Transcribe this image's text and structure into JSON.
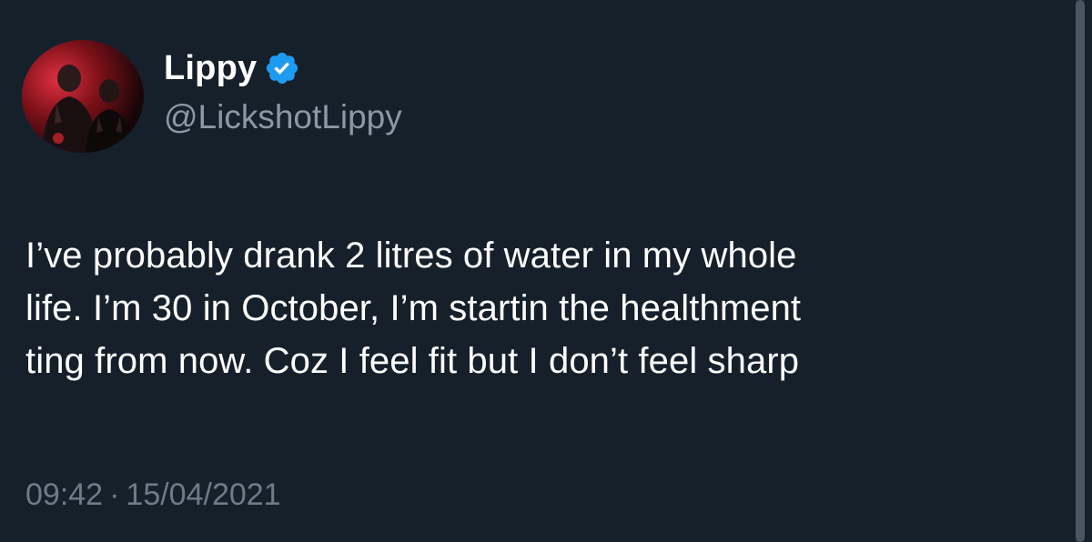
{
  "author": {
    "display_name": "Lippy",
    "handle": "@LickshotLippy",
    "verified_icon": "verified-badge-icon",
    "avatar_icon": "profile-photo"
  },
  "tweet": {
    "text": "I’ve probably drank 2 litres of water in my whole\nlife. I’m 30 in October, I’m startin the healthment\nting from now. Coz I feel fit but I don’t feel sharp",
    "time": "09:42",
    "separator": "·",
    "date": "15/04/2021"
  },
  "colors": {
    "background": "#15202b",
    "text": "#ffffff",
    "secondary_text": "#8b98a5",
    "verified_blue": "#1d9bf0"
  }
}
